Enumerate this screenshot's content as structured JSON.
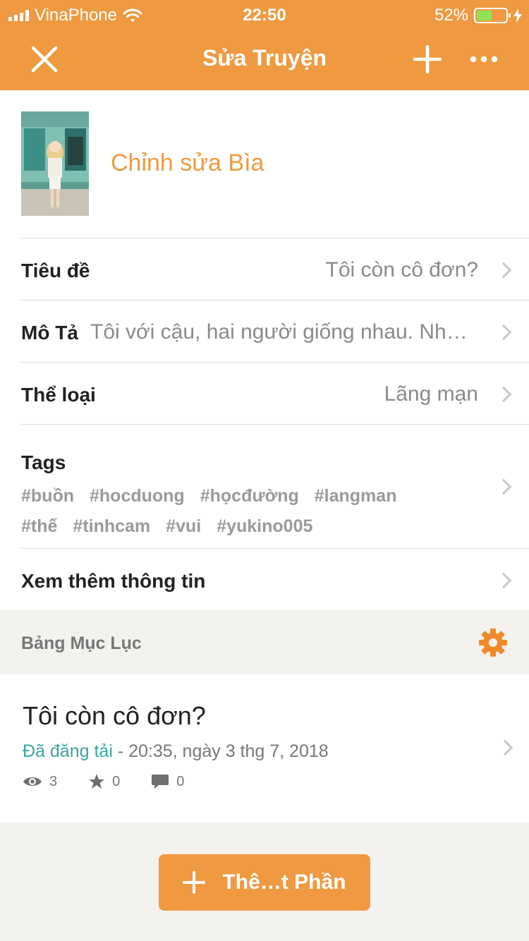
{
  "status_bar": {
    "carrier": "VinaPhone",
    "time": "22:50",
    "battery_percent": "52%",
    "battery_level": 0.52
  },
  "navbar": {
    "title": "Sửa Truyện",
    "close_icon": "close-icon",
    "add_icon": "plus-icon",
    "more_icon": "more-icon"
  },
  "cover": {
    "edit_label": "Chỉnh sửa Bìa"
  },
  "fields": {
    "title_label": "Tiêu đề",
    "title_value": "Tôi còn cô đơn?",
    "description_label": "Mô Tả",
    "description_value": "Tôi với cậu, hai người giống nhau. Nh…",
    "genre_label": "Thể loại",
    "genre_value": "Lãng mạn",
    "tags_label": "Tags",
    "tags": [
      "#buồn",
      "#hocduong",
      "#họcđường",
      "#langman",
      "#thế",
      "#tinhcam",
      "#vui",
      "#yukino005"
    ],
    "more_info_label": "Xem thêm thông tin"
  },
  "toc": {
    "header_label": "Bảng Mục Lục",
    "settings_icon": "gear-icon"
  },
  "part": {
    "title": "Tôi còn cô đơn?",
    "status": "Đã đăng tải",
    "date": " - 20:35, ngày 3 thg 7, 2018",
    "views": "3",
    "votes": "0",
    "comments": "0"
  },
  "add_part_button": {
    "label": "Thê…t Phần"
  },
  "colors": {
    "accent": "#ef9a40",
    "published": "#3aa6a0",
    "muted_text": "#8a8a8a",
    "divider": "#dddddd",
    "section_bg": "#f3f2ef"
  }
}
